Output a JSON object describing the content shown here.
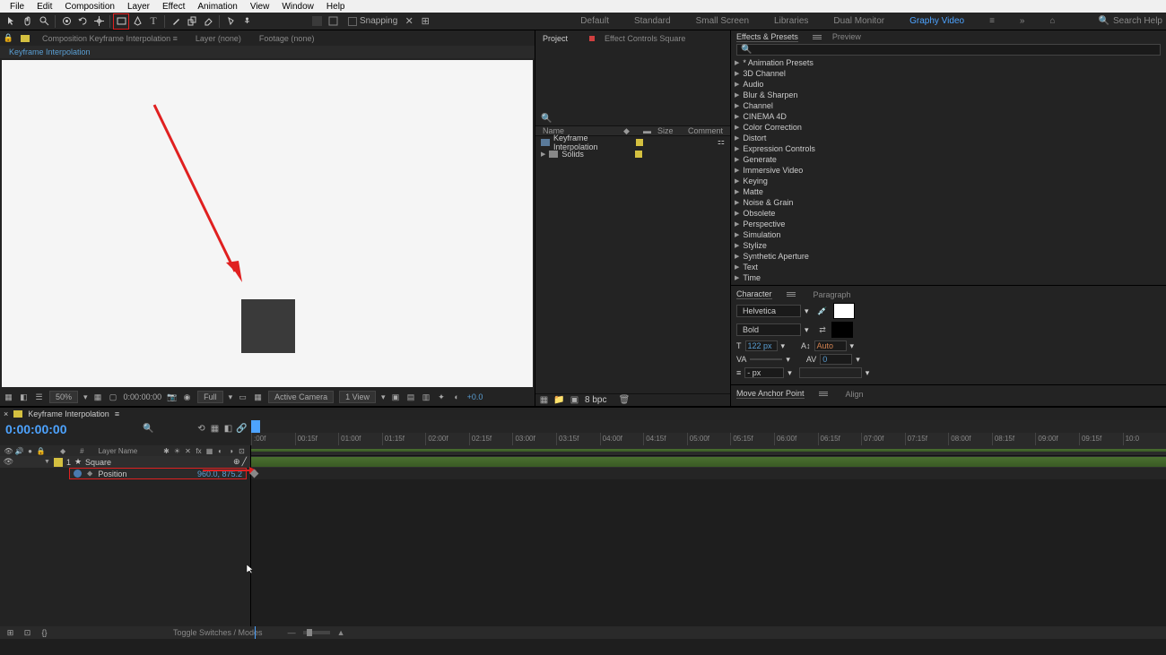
{
  "menubar": [
    "File",
    "Edit",
    "Composition",
    "Layer",
    "Effect",
    "Animation",
    "View",
    "Window",
    "Help"
  ],
  "toolbar": {
    "snapping_label": "Snapping"
  },
  "workspaces": {
    "items": [
      "Default",
      "Standard",
      "Small Screen",
      "Libraries",
      "Dual Monitor",
      "Graphy Video"
    ],
    "active": 5,
    "search_placeholder": "Search Help"
  },
  "viewer": {
    "tabs_prefix": "Composition",
    "comp_name": "Keyframe Interpolation",
    "layer_tab": "Layer  (none)",
    "footage_tab": "Footage  (none)",
    "breadcrumb": "Keyframe Interpolation"
  },
  "viewer_controls": {
    "zoom": "50%",
    "timecode": "0:00:00:00",
    "resolution": "Full",
    "camera": "Active Camera",
    "views": "1 View",
    "exposure": "+0.0"
  },
  "project": {
    "tab1": "Project",
    "tab2": "Effect Controls Square",
    "columns": {
      "name": "Name",
      "type": "",
      "size": "Size",
      "comment": "Comment"
    },
    "items": [
      {
        "name": "Keyframe Interpolation",
        "kind": "comp"
      },
      {
        "name": "Solids",
        "kind": "folder"
      }
    ],
    "footer_bpc": "8 bpc"
  },
  "effects": {
    "tab1": "Effects & Presets",
    "tab2": "Preview",
    "categories": [
      "* Animation Presets",
      "3D Channel",
      "Audio",
      "Blur & Sharpen",
      "Channel",
      "CINEMA 4D",
      "Color Correction",
      "Distort",
      "Expression Controls",
      "Generate",
      "Immersive Video",
      "Keying",
      "Matte",
      "Noise & Grain",
      "Obsolete",
      "Perspective",
      "Simulation",
      "Stylize",
      "Synthetic Aperture",
      "Text",
      "Time"
    ]
  },
  "character": {
    "tab1": "Character",
    "tab2": "Paragraph",
    "font": "Helvetica",
    "weight": "Bold",
    "size": "122 px",
    "leading": "Auto",
    "tracking": "0",
    "px_label": "- px"
  },
  "anchor": {
    "title": "Move Anchor Point",
    "align": "Align"
  },
  "timeline": {
    "comp_name": "Keyframe Interpolation",
    "timecode": "0:00:00:00",
    "col_layer_name": "Layer Name",
    "ticks": [
      ":00f",
      "00:15f",
      "01:00f",
      "01:15f",
      "02:00f",
      "02:15f",
      "03:00f",
      "03:15f",
      "04:00f",
      "04:15f",
      "05:00f",
      "05:15f",
      "06:00f",
      "06:15f",
      "07:00f",
      "07:15f",
      "08:00f",
      "08:15f",
      "09:00f",
      "09:15f",
      "10:0"
    ],
    "layer": {
      "index": "1",
      "name": "Square",
      "prop": "Position",
      "value": "960.0, 875.2"
    },
    "footer_toggle": "Toggle Switches / Modes"
  }
}
